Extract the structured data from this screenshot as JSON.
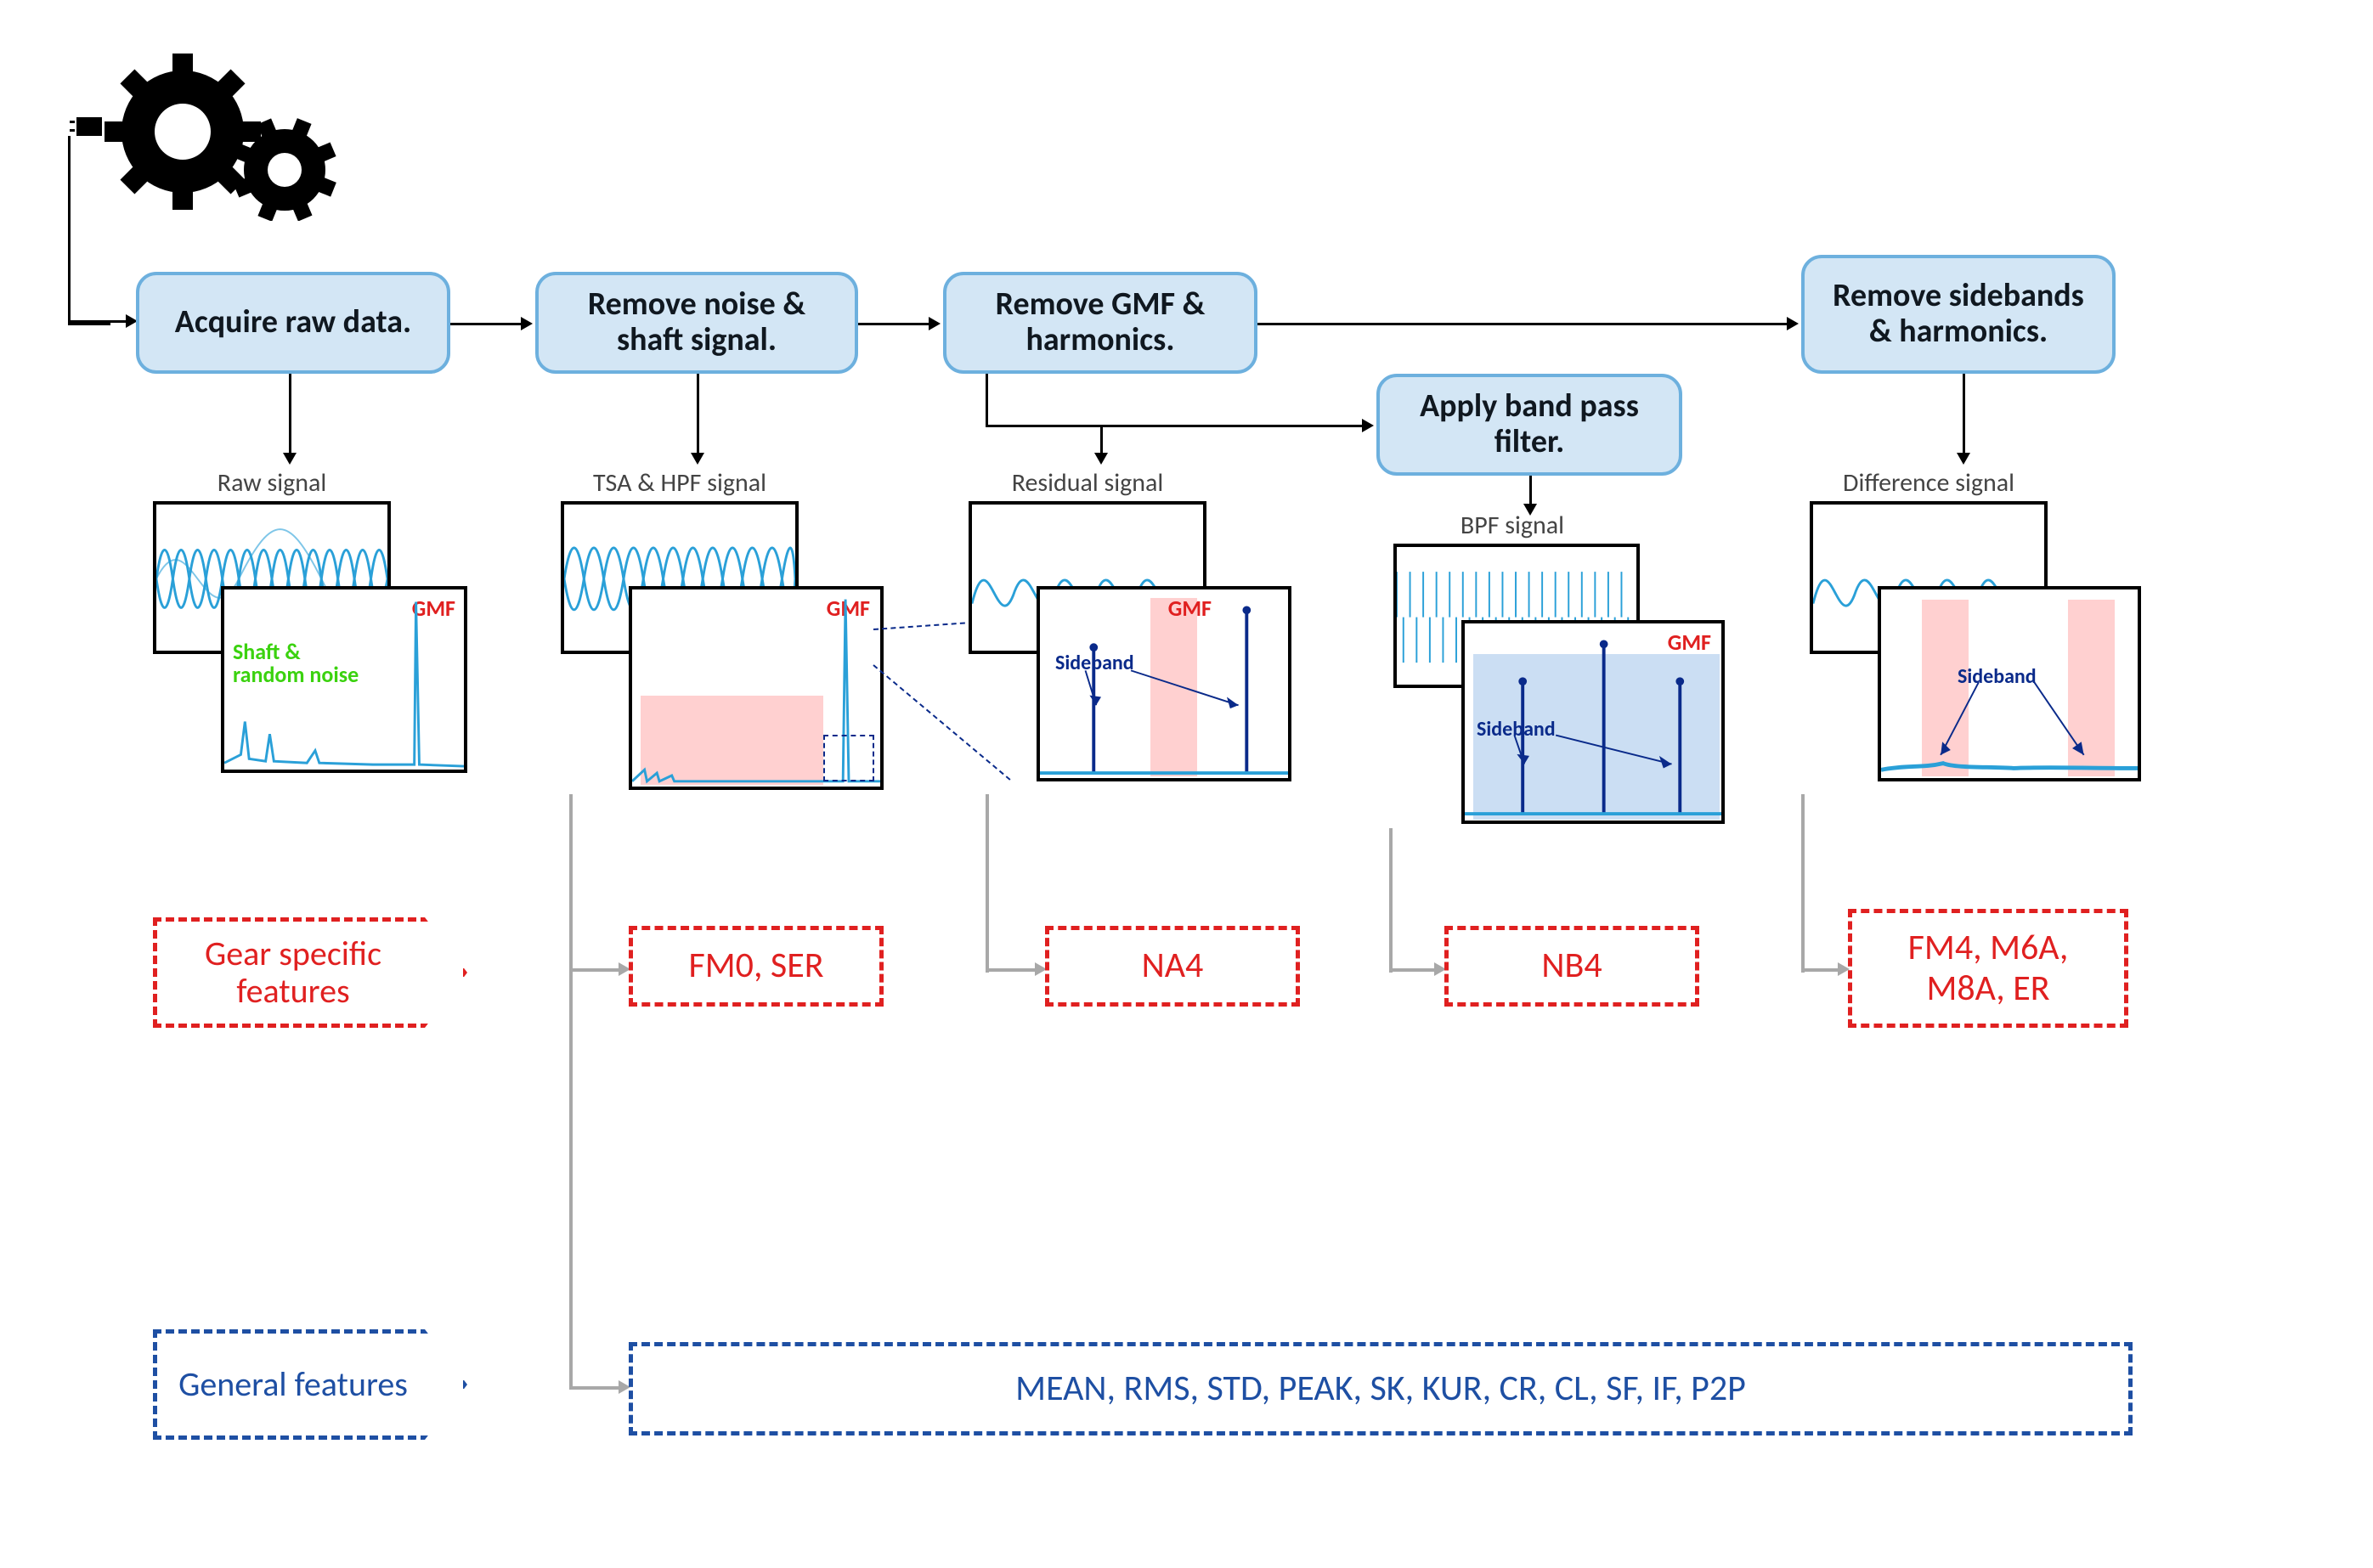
{
  "steps": {
    "s1": "Acquire raw data.",
    "s2": "Remove noise & shaft signal.",
    "s3": "Remove GMF & harmonics.",
    "s4": "Apply band pass filter.",
    "s5": "Remove sidebands & harmonics."
  },
  "signals": {
    "raw": "Raw signal",
    "tsa": "TSA & HPF signal",
    "residual": "Residual signal",
    "bpf": "BPF signal",
    "diff": "Difference signal"
  },
  "annotations": {
    "gmf": "GMF",
    "shaft_noise": "Shaft &\nrandom noise",
    "sideband": "Sideband"
  },
  "feature_banners": {
    "gear": "Gear specific features",
    "general": "General features"
  },
  "gear_features": {
    "tsa": "FM0, SER",
    "residual": "NA4",
    "bpf": "NB4",
    "diff": "FM4, M6A, M8A, ER"
  },
  "general_features": {
    "all": "MEAN, RMS, STD, PEAK, SK, KUR, CR, CL, SF, IF, P2P"
  }
}
